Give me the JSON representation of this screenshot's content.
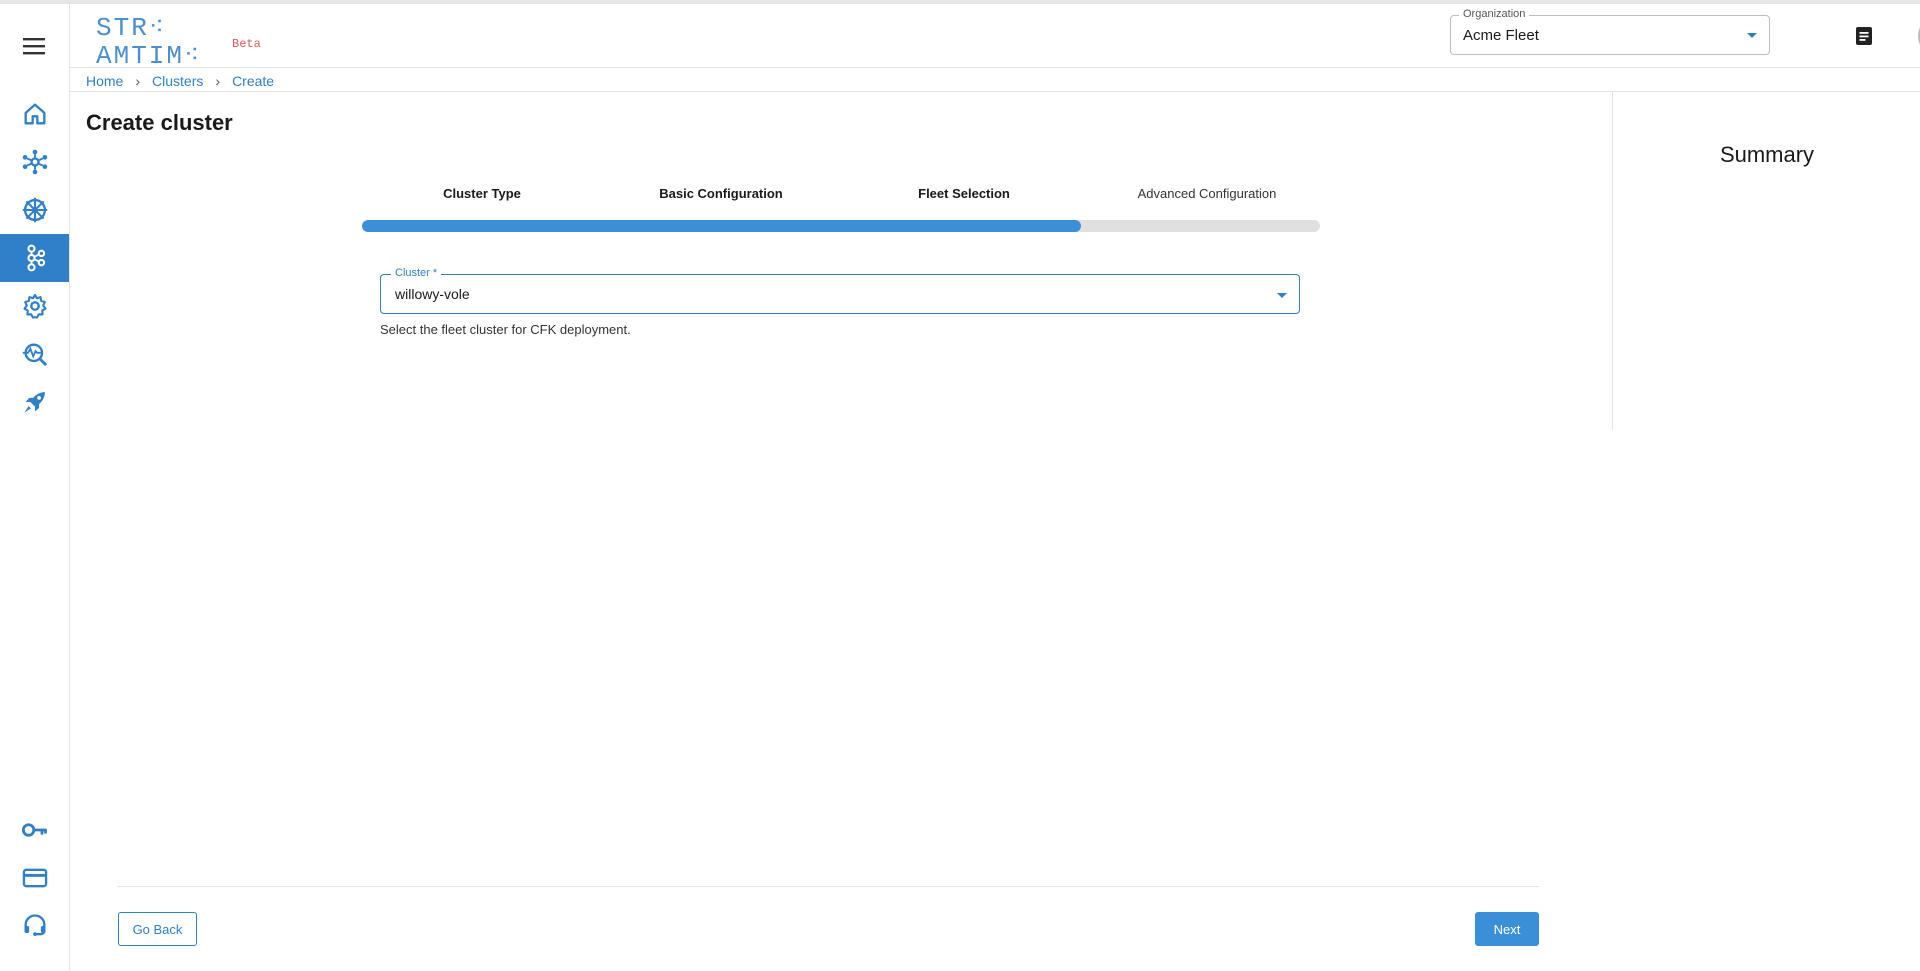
{
  "brand": {
    "logo_text": "STR⁖AMTIM⁖",
    "beta_label": "Beta"
  },
  "header": {
    "org_select": {
      "label": "Organization",
      "value": "Acme Fleet"
    },
    "docs_icon": "document-icon",
    "avatar_icon": "account-circle-icon"
  },
  "sidebar": {
    "menu_icon": "hamburger-menu-icon",
    "items": [
      {
        "icon": "home-icon",
        "active": false
      },
      {
        "icon": "network-hub-icon",
        "active": false
      },
      {
        "icon": "kubernetes-helm-icon",
        "active": false
      },
      {
        "icon": "kafka-cluster-icon",
        "active": true
      },
      {
        "icon": "settings-gear-icon",
        "active": false
      },
      {
        "icon": "monitoring-search-icon",
        "active": false
      },
      {
        "icon": "rocket-icon",
        "active": false
      }
    ],
    "bottom_items": [
      {
        "icon": "key-icon"
      },
      {
        "icon": "credit-card-icon"
      },
      {
        "icon": "support-headset-icon"
      }
    ]
  },
  "breadcrumb": [
    "Home",
    "Clusters",
    "Create"
  ],
  "page": {
    "title": "Create cluster"
  },
  "stepper": {
    "steps": [
      {
        "label": "Cluster Type",
        "state": "done"
      },
      {
        "label": "Basic Configuration",
        "state": "done"
      },
      {
        "label": "Fleet Selection",
        "state": "current"
      },
      {
        "label": "Advanced Configuration",
        "state": "todo"
      }
    ],
    "progress_fraction": 0.75
  },
  "form": {
    "cluster": {
      "label": "Cluster *",
      "value": "willowy-vole",
      "helper": "Select the fleet cluster for CFK deployment."
    }
  },
  "summary": {
    "title": "Summary"
  },
  "footer": {
    "back_label": "Go Back",
    "next_label": "Next"
  },
  "colors": {
    "accent": "#2f80c6",
    "progress": "#3a8fd6",
    "beta": "#e05a5a"
  }
}
